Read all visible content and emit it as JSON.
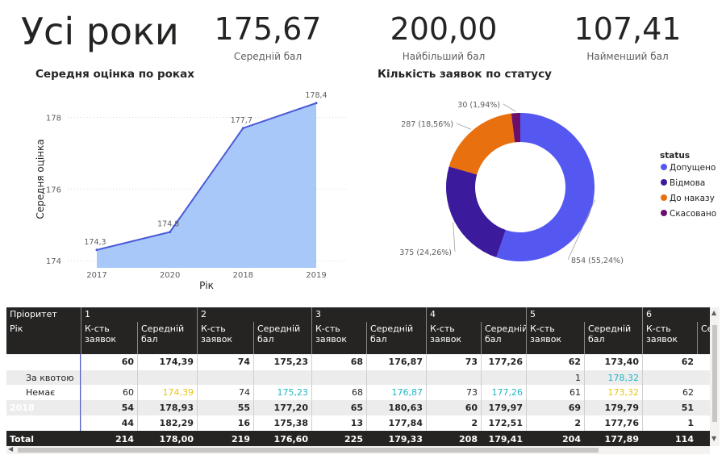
{
  "header": {
    "title": "Усі роки",
    "kpis": [
      {
        "value": "175,67",
        "label": "Середній бал"
      },
      {
        "value": "200,00",
        "label": "Найбільший бал"
      },
      {
        "value": "107,41",
        "label": "Найменший бал"
      }
    ]
  },
  "area_chart_title": "Середня оцінка по роках",
  "donut_chart_title": "Кількість заявок по статусу",
  "chart_data": [
    {
      "type": "area",
      "title": "Середня оцінка по роках",
      "xlabel": "Рік",
      "ylabel": "Середня оцінка",
      "categories": [
        "2017",
        "2020",
        "2018",
        "2019"
      ],
      "values": [
        174.3,
        174.8,
        177.7,
        178.4
      ],
      "data_labels": [
        "174,3",
        "174,8",
        "177,7",
        "178,4"
      ],
      "yticks": [
        "174",
        "176",
        "178"
      ],
      "ylim": [
        173.8,
        178.8
      ],
      "grid": true,
      "color": "#a8c8fa",
      "line_color": "#4a5ad6"
    },
    {
      "type": "pie",
      "title": "Кількість заявок по статусу",
      "legend_title": "status",
      "legend_position": "right",
      "slices": [
        {
          "name": "Допущено",
          "value": 854,
          "label": "854 (55,24%)",
          "color": "#5558f0"
        },
        {
          "name": "Відмова",
          "value": 375,
          "label": "375 (24,26%)",
          "color": "#3b1a9c"
        },
        {
          "name": "До наказу",
          "value": 287,
          "label": "287 (18,56%)",
          "color": "#e8700f"
        },
        {
          "name": "Скасовано",
          "value": 30,
          "label": "30 (1,94%)",
          "color": "#6b0f6b"
        }
      ]
    }
  ],
  "matrix": {
    "priority_label": "Пріоритет",
    "year_label": "Рік",
    "groups": [
      "1",
      "2",
      "3",
      "4",
      "5",
      "6"
    ],
    "count_header": "К-сть заявок",
    "avg_header": "Середній бал",
    "avg_header_wrapped": "Середній\nбал",
    "partial_header": "Се",
    "rows": [
      {
        "label": "",
        "bold": true,
        "values": [
          "60",
          "174,39",
          "74",
          "175,23",
          "68",
          "176,87",
          "73",
          "177,26",
          "62",
          "173,40",
          "62"
        ]
      },
      {
        "label": "За квотою",
        "bold": false,
        "values": [
          "",
          "",
          "",
          "",
          "",
          "",
          "",
          "",
          "1",
          "178,32",
          ""
        ]
      },
      {
        "label": "Немає",
        "bold": false,
        "values": [
          "60",
          "174,39",
          "74",
          "175,23",
          "68",
          "176,87",
          "73",
          "177,26",
          "61",
          "173,32",
          "62"
        ]
      },
      {
        "label": "2018",
        "bold": true,
        "values": [
          "54",
          "178,93",
          "55",
          "177,20",
          "65",
          "180,63",
          "60",
          "179,97",
          "69",
          "179,79",
          "51"
        ]
      },
      {
        "label": "",
        "bold": true,
        "values": [
          "44",
          "182,29",
          "16",
          "175,38",
          "13",
          "177,84",
          "2",
          "172,51",
          "2",
          "177,76",
          "1"
        ]
      }
    ],
    "total": {
      "label": "Total",
      "values": [
        "214",
        "178,00",
        "219",
        "176,60",
        "225",
        "179,33",
        "208",
        "179,41",
        "204",
        "177,89",
        "114"
      ]
    },
    "avg_colors": [
      "#e6c619",
      "#1fb7c4",
      "#1fb7c4",
      "#1fb7c4",
      "#e6c619"
    ],
    "quota_avg_color": "#1fb7c4"
  }
}
